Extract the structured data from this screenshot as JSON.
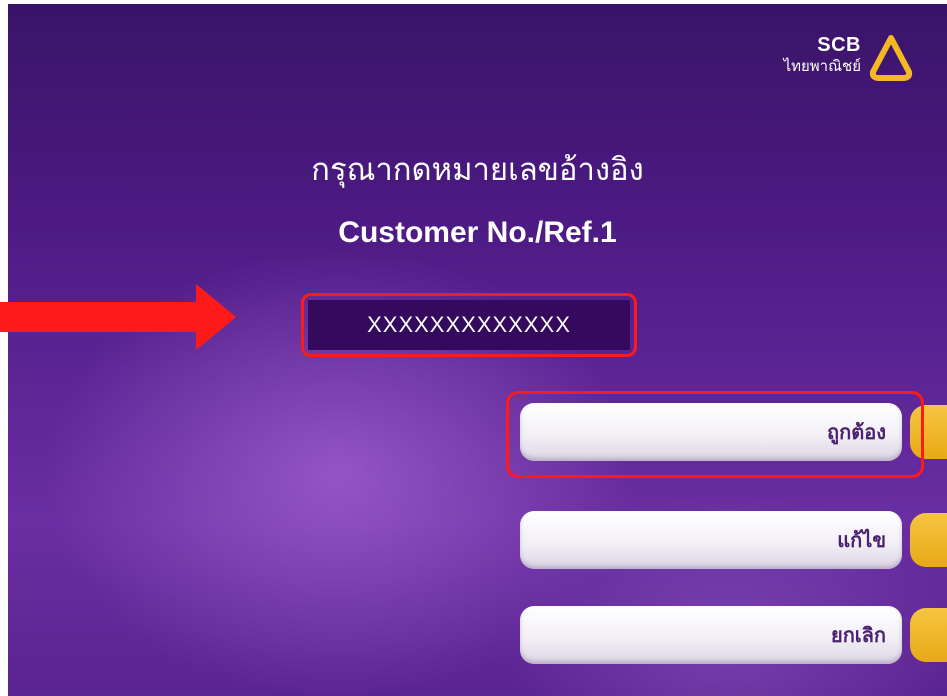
{
  "logo": {
    "brand": "SCB",
    "thai_name": "ไทยพาณิชย์",
    "mark_color": "#f4b822"
  },
  "titles": {
    "thai": "กรุณากดหมายเลขอ้างอิง",
    "english": "Customer No./Ref.1"
  },
  "ref_input": {
    "value": "XXXXXXXXXXXXX"
  },
  "buttons": {
    "confirm": "ถูกต้อง",
    "edit": "แก้ไข",
    "cancel": "ยกเลิก"
  },
  "colors": {
    "background": "#4c1a82",
    "highlight": "#ff1a1a",
    "button_tab": "#f6c542",
    "button_text": "#4a2270"
  }
}
